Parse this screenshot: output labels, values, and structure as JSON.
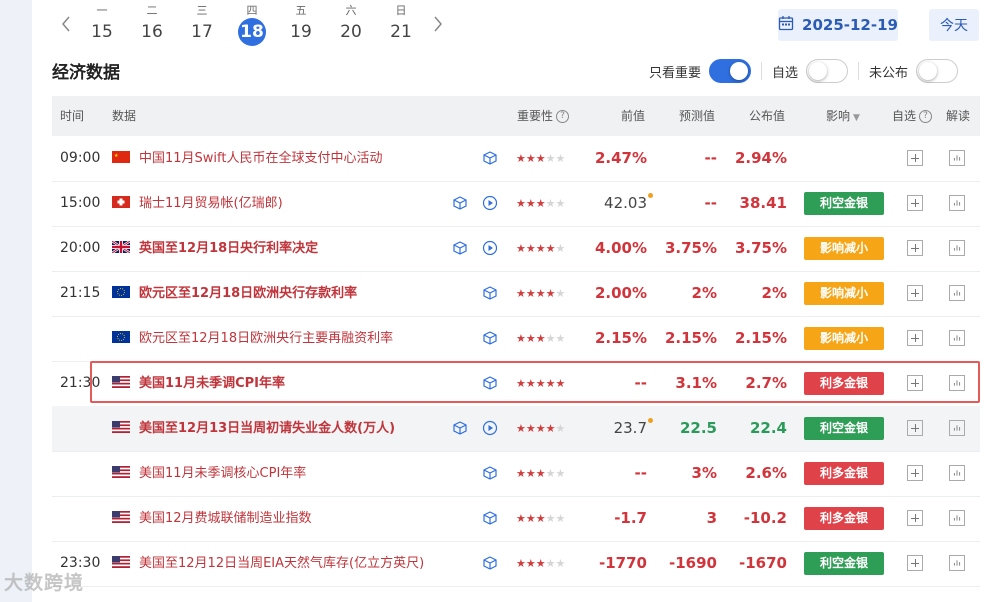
{
  "calendar": {
    "days": [
      {
        "weekday": "一",
        "day": "15"
      },
      {
        "weekday": "二",
        "day": "16"
      },
      {
        "weekday": "三",
        "day": "17"
      },
      {
        "weekday": "四",
        "day": "18"
      },
      {
        "weekday": "五",
        "day": "19"
      },
      {
        "weekday": "六",
        "day": "20"
      },
      {
        "weekday": "日",
        "day": "21"
      }
    ],
    "selected_date": "2025-12-19",
    "today_label": "今天"
  },
  "section_title": "经济数据",
  "filters": {
    "important_only": "只看重要",
    "self_selected": "自选",
    "unpublished": "未公布"
  },
  "headers": {
    "time": "时间",
    "data": "数据",
    "importance": "重要性",
    "previous": "前值",
    "forecast": "预测值",
    "published": "公布值",
    "impact": "影响",
    "watch": "自选",
    "explain": "解读"
  },
  "rows": [
    {
      "time": "09:00",
      "name": "中国11月Swift人民币在全球支付中心活动",
      "prev": "2.47%",
      "fore": "--",
      "pub": "2.94%",
      "impact": ""
    },
    {
      "time": "15:00",
      "name": "瑞士11月贸易帐(亿瑞郎)",
      "prev": "42.03",
      "fore": "--",
      "pub": "38.41",
      "impact": "利空金银"
    },
    {
      "time": "20:00",
      "name": "英国至12月18日央行利率决定",
      "prev": "4.00%",
      "fore": "3.75%",
      "pub": "3.75%",
      "impact": "影响减小"
    },
    {
      "time": "21:15",
      "name": "欧元区至12月18日欧洲央行存款利率",
      "prev": "2.00%",
      "fore": "2%",
      "pub": "2%",
      "impact": "影响减小"
    },
    {
      "time": "",
      "name": "欧元区至12月18日欧洲央行主要再融资利率",
      "prev": "2.15%",
      "fore": "2.15%",
      "pub": "2.15%",
      "impact": "影响减小"
    },
    {
      "time": "21:30",
      "name": "美国11月未季调CPI年率",
      "prev": "--",
      "fore": "3.1%",
      "pub": "2.7%",
      "impact": "利多金银"
    },
    {
      "time": "",
      "name": "美国至12月13日当周初请失业金人数(万人)",
      "prev": "23.7",
      "fore": "22.5",
      "pub": "22.4",
      "impact": "利空金银"
    },
    {
      "time": "",
      "name": "美国11月未季调核心CPI年率",
      "prev": "--",
      "fore": "3%",
      "pub": "2.6%",
      "impact": "利多金银"
    },
    {
      "time": "",
      "name": "美国12月费城联储制造业指数",
      "prev": "-1.7",
      "fore": "3",
      "pub": "-10.2",
      "impact": "利多金银"
    },
    {
      "time": "23:30",
      "name": "美国至12月12日当周EIA天然气库存(亿立方英尺)",
      "prev": "-1770",
      "fore": "-1690",
      "pub": "-1670",
      "impact": "利空金银"
    }
  ],
  "watermark": "大数跨境",
  "colors": {
    "accent": "#2f6fe0",
    "bullish_gold": "#e0424a",
    "bearish_gold": "#2e9d55",
    "reduced": "#f5a516"
  }
}
